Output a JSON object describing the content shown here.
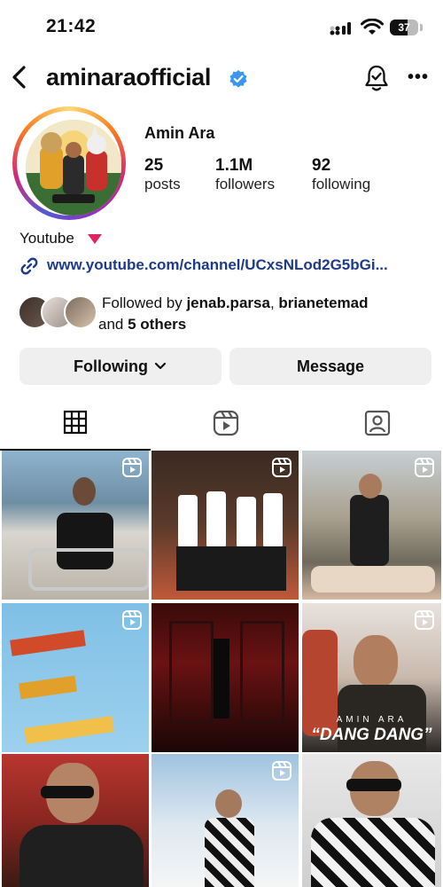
{
  "status_bar": {
    "time": "21:42",
    "battery": "37"
  },
  "header": {
    "username": "aminaraofficial"
  },
  "profile": {
    "display_name": "Amin Ara",
    "stats": [
      {
        "value": "25",
        "label": "posts"
      },
      {
        "value": "1.1M",
        "label": "followers"
      },
      {
        "value": "92",
        "label": "following"
      }
    ],
    "bio_line": "Youtube",
    "link": "www.youtube.com/channel/UCxsNLod2G5bGi...",
    "followed_by": {
      "prefix": "Followed by ",
      "user1": "jenab.parsa",
      "sep": ", ",
      "user2": "brianetemad",
      "and": " and ",
      "others": "5 others"
    }
  },
  "actions": {
    "following_label": "Following",
    "message_label": "Message"
  },
  "tabs": [
    "grid",
    "reels",
    "tagged"
  ],
  "grid_posts": [
    {
      "kind": "reel",
      "caption": ""
    },
    {
      "kind": "reel",
      "caption": ""
    },
    {
      "kind": "reel",
      "caption": ""
    },
    {
      "kind": "reel",
      "caption": ""
    },
    {
      "kind": "photo",
      "caption": ""
    },
    {
      "kind": "reel",
      "caption_top": "AMIN ARA",
      "caption_bottom": "“DANG DANG”"
    },
    {
      "kind": "photo",
      "caption": ""
    },
    {
      "kind": "reel",
      "caption": ""
    },
    {
      "kind": "photo",
      "caption": ""
    }
  ],
  "colors": {
    "verified": "#3897f0",
    "link": "#1e3a8a",
    "button_bg": "#efefef"
  }
}
